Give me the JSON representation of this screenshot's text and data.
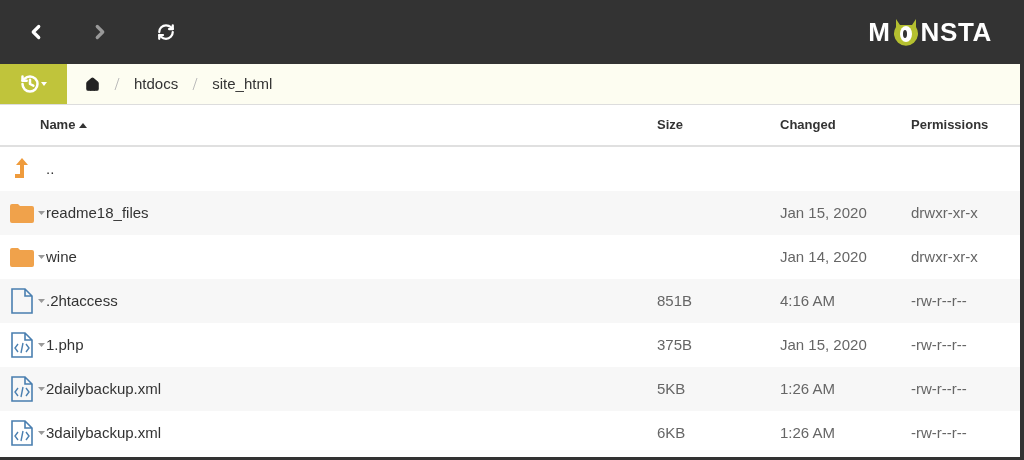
{
  "toolbar": {
    "logo": {
      "before": "M",
      "after": "NSTA"
    }
  },
  "breadcrumb": [
    "htdocs",
    "site_html"
  ],
  "table": {
    "columns": [
      {
        "label": "Name",
        "sorted": true
      },
      {
        "label": "Size",
        "sorted": false
      },
      {
        "label": "Changed",
        "sorted": false
      },
      {
        "label": "Permissions",
        "sorted": false
      }
    ],
    "rows": [
      {
        "kind": "up",
        "name": ".."
      },
      {
        "kind": "folder",
        "name": "readme18_files",
        "changed": "Jan 15, 2020",
        "permissions": "drwxr-xr-x"
      },
      {
        "kind": "folder",
        "name": "wine",
        "changed": "Jan 14, 2020",
        "permissions": "drwxr-xr-x"
      },
      {
        "kind": "file",
        "name": ".2htaccess",
        "size": "851B",
        "changed": "4:16 AM",
        "permissions": "-rw-r--r--"
      },
      {
        "kind": "code",
        "name": "1.php",
        "size": "375B",
        "changed": "Jan 15, 2020",
        "permissions": "-rw-r--r--"
      },
      {
        "kind": "code",
        "name": "2dailybackup.xml",
        "size": "5KB",
        "changed": "1:26 AM",
        "permissions": "-rw-r--r--"
      },
      {
        "kind": "code",
        "name": "3dailybackup.xml",
        "size": "6KB",
        "changed": "1:26 AM",
        "permissions": "-rw-r--r--"
      }
    ]
  }
}
